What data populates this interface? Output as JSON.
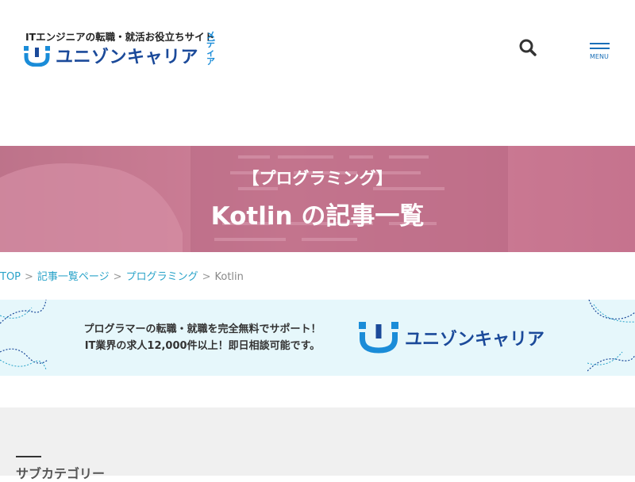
{
  "header": {
    "tagline": "ITエンジニアの転職・就活お役立ちサイト",
    "brand_name": "ユニゾンキャリア",
    "media_label": "メディア",
    "menu_label": "MENU",
    "search_icon": "search-icon",
    "menu_icon": "hamburger-icon"
  },
  "hero": {
    "category": "【プログラミング】",
    "title": "Kotlin の記事一覧"
  },
  "breadcrumb": {
    "items": [
      "TOP",
      "記事一覧ページ",
      "プログラミング"
    ],
    "current": "Kotlin",
    "separator": ">"
  },
  "banner": {
    "line1": "プログラマーの転職・就職を完全無料でサポート！",
    "line2": "IT業界の求人12,000件以上！即日相談可能です。",
    "brand_name": "ユニゾンキャリア"
  },
  "section": {
    "heading": "サブカテゴリー"
  },
  "colors": {
    "brand_blue": "#1b4a9a",
    "accent_cyan": "#1a8cd8",
    "link": "#29a3c9",
    "hero_tint": "#c88a9a",
    "banner_bg": "#e6f7fb"
  }
}
